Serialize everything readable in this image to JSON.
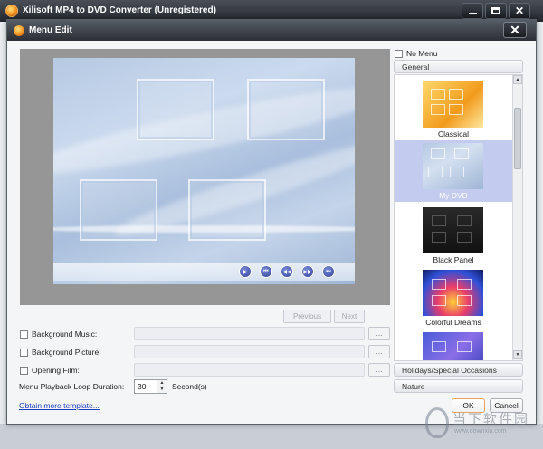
{
  "app": {
    "title": "Xilisoft MP4 to DVD Converter (Unregistered)"
  },
  "dialog": {
    "title": "Menu Edit"
  },
  "preview": {
    "nav_buttons": [
      "play-icon",
      "first-icon",
      "prev-icon",
      "next-icon",
      "last-icon"
    ],
    "previous_label": "Previous",
    "next_label": "Next"
  },
  "options": {
    "background_music_label": "Background Music:",
    "background_picture_label": "Background Picture:",
    "opening_film_label": "Opening Film:",
    "browse_label": "...",
    "loop_label": "Menu Playback Loop Duration:",
    "loop_value": "30",
    "loop_unit": "Second(s)",
    "more_templates_link": "Obtain more template..."
  },
  "templates": {
    "no_menu_label": "No Menu",
    "categories": [
      "General",
      "Holidays/Special Occasions",
      "Nature"
    ],
    "selected_category": "General",
    "items": [
      {
        "name": "Classical",
        "selected": false
      },
      {
        "name": "My DVD",
        "selected": true
      },
      {
        "name": "Black Panel",
        "selected": false
      },
      {
        "name": "Colorful Dreams",
        "selected": false
      }
    ]
  },
  "buttons": {
    "ok_label": "OK",
    "cancel_label": "Cancel"
  },
  "watermark": {
    "text": "当下软件园",
    "url": "www.downxia.com"
  },
  "colors": {
    "accent": "#c3cbef",
    "link": "#1a3fb8",
    "ok_border": "#e9a560"
  }
}
